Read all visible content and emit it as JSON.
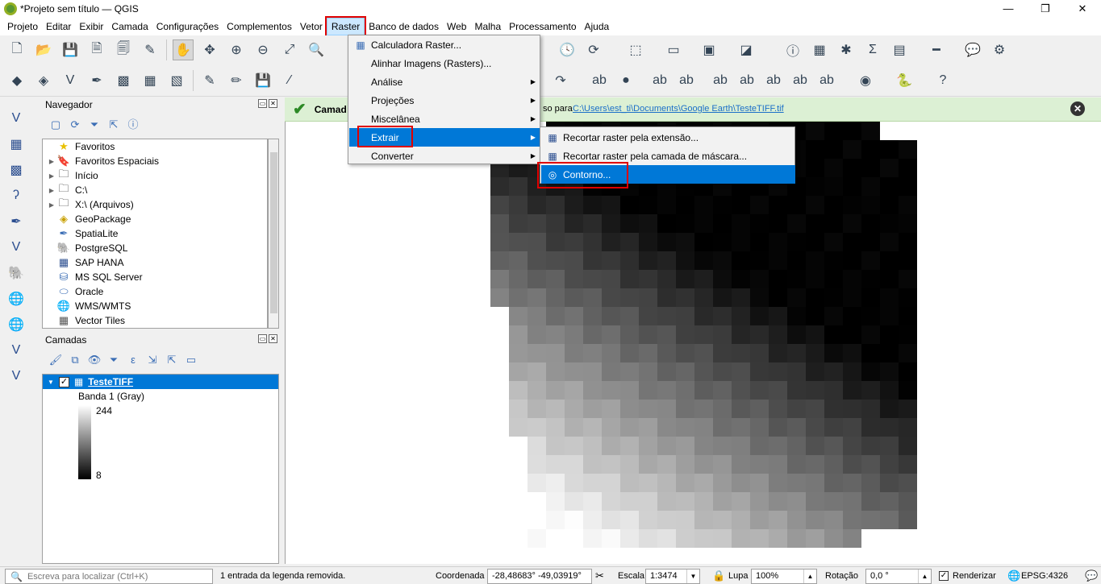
{
  "window": {
    "title": "*Projeto sem título — QGIS",
    "controls": [
      "—",
      "❐",
      "✕"
    ]
  },
  "menubar": [
    "Projeto",
    "Editar",
    "Exibir",
    "Camada",
    "Configurações",
    "Complementos",
    "Vetor",
    "Raster",
    "Banco de dados",
    "Web",
    "Malha",
    "Processamento",
    "Ajuda"
  ],
  "raster_menu": {
    "items": [
      "Calculadora Raster...",
      "Alinhar Imagens (Rasters)...",
      "Análise",
      "Projeções",
      "Miscelânea",
      "Extrair",
      "Converter"
    ]
  },
  "extrair_menu": {
    "items": [
      "Recortar raster pela extensão...",
      "Recortar raster pela camada de máscara...",
      "Contorno..."
    ]
  },
  "navigator": {
    "title": "Navegador",
    "items": [
      "Favoritos",
      "Favoritos Espaciais",
      "Início",
      "C:\\",
      "X:\\ (Arquivos)",
      "GeoPackage",
      "SpatiaLite",
      "PostgreSQL",
      "SAP HANA",
      "MS SQL Server",
      "Oracle",
      "WMS/WMTS",
      "Vector Tiles"
    ]
  },
  "layers": {
    "title": "Camadas",
    "layer_name": "TesteTIFF",
    "band": "Banda 1 (Gray)",
    "max": "244",
    "min": "8"
  },
  "message": {
    "text": "Camad",
    "prefix": "so para",
    "link": "C:\\Users\\est_ti\\Documents\\Google Earth\\TesteTIFF.tif"
  },
  "statusbar": {
    "search_placeholder": "Escreva para localizar (Ctrl+K)",
    "message": "1 entrada da legenda removida.",
    "coord_label": "Coordenada",
    "coord_value": "-28,48683°  -49,03919°",
    "scale_label": "Escala",
    "scale_value": "1:3474",
    "zoom_label": "Lupa",
    "zoom_value": "100%",
    "rotation_label": "Rotação",
    "rotation_value": "0,0 °",
    "render_label": "Renderizar",
    "crs": "EPSG:4326"
  },
  "colors": {
    "accent": "#0078d7",
    "highlight_box": "#e00000",
    "success_bg": "#dcf0d4",
    "link": "#1b6fc8"
  }
}
